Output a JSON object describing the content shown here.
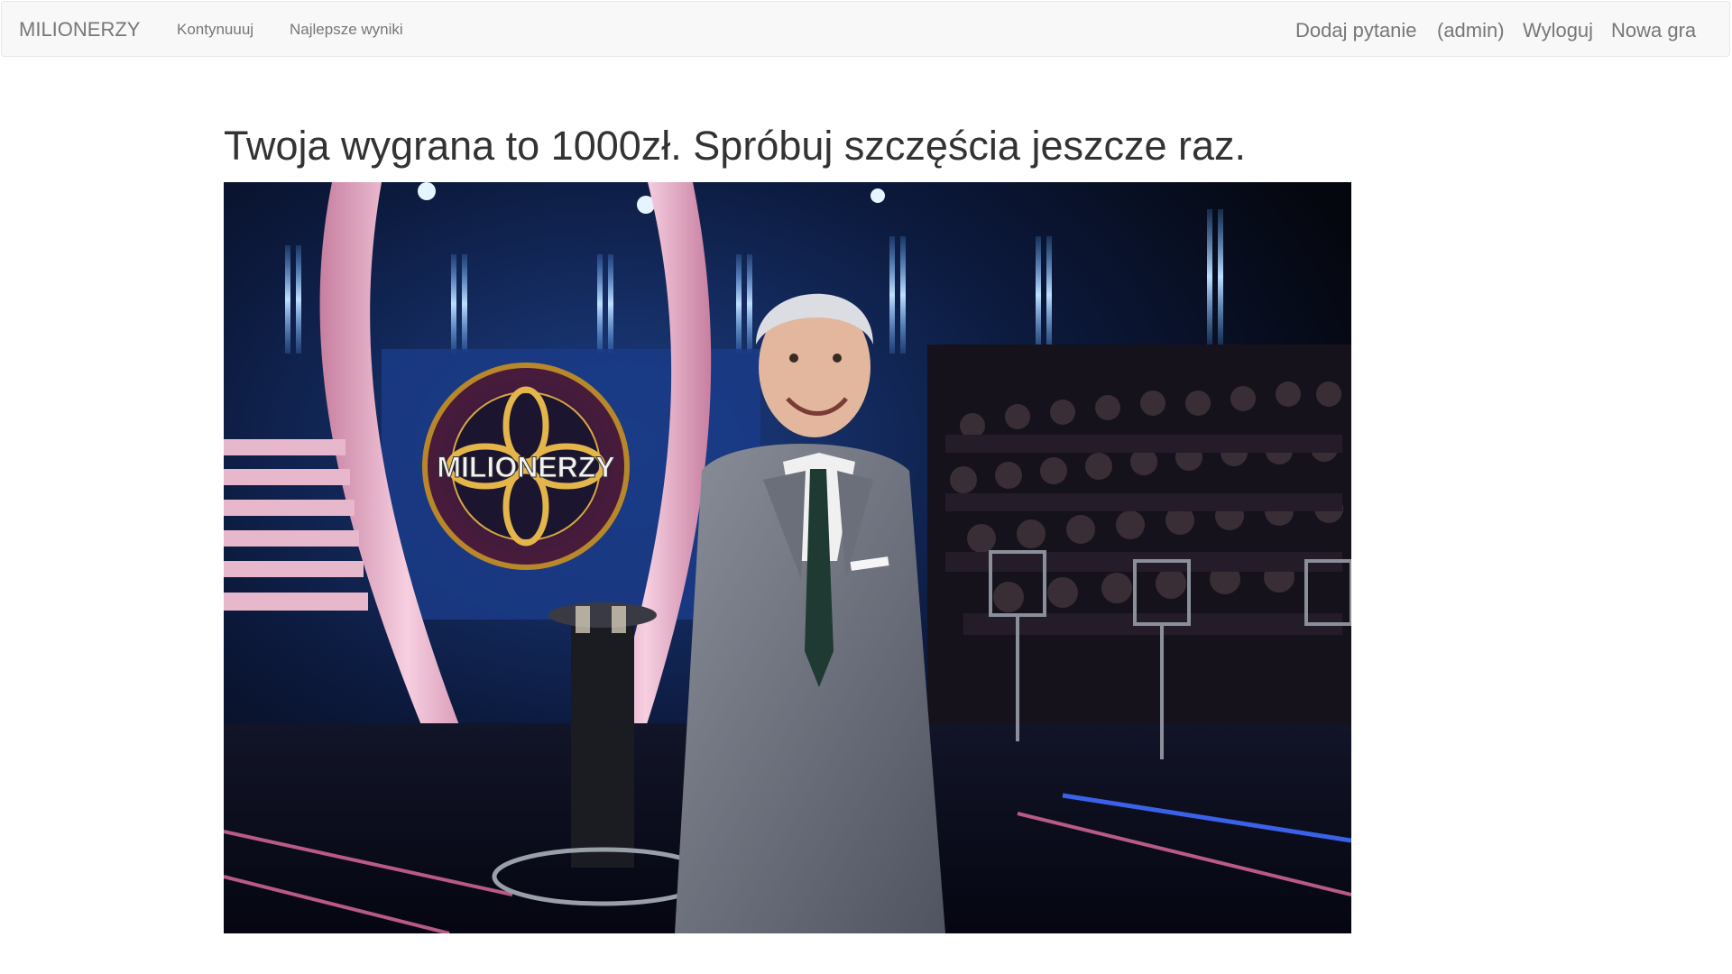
{
  "navbar": {
    "brand": "MILIONERZY",
    "left_links": [
      {
        "label": "Kontynuuuj"
      },
      {
        "label": "Najlepsze wyniki"
      }
    ],
    "right_links": [
      {
        "label": "Dodaj pytanie"
      },
      {
        "label": "(admin)"
      },
      {
        "label": "Wyloguj"
      },
      {
        "label": "Nowa gra"
      }
    ]
  },
  "main": {
    "title": "Twoja wygrana to 1000zł. Spróbuj szczęścia jeszcze raz.",
    "photo": {
      "logo_text": "MILIONERZY"
    }
  }
}
